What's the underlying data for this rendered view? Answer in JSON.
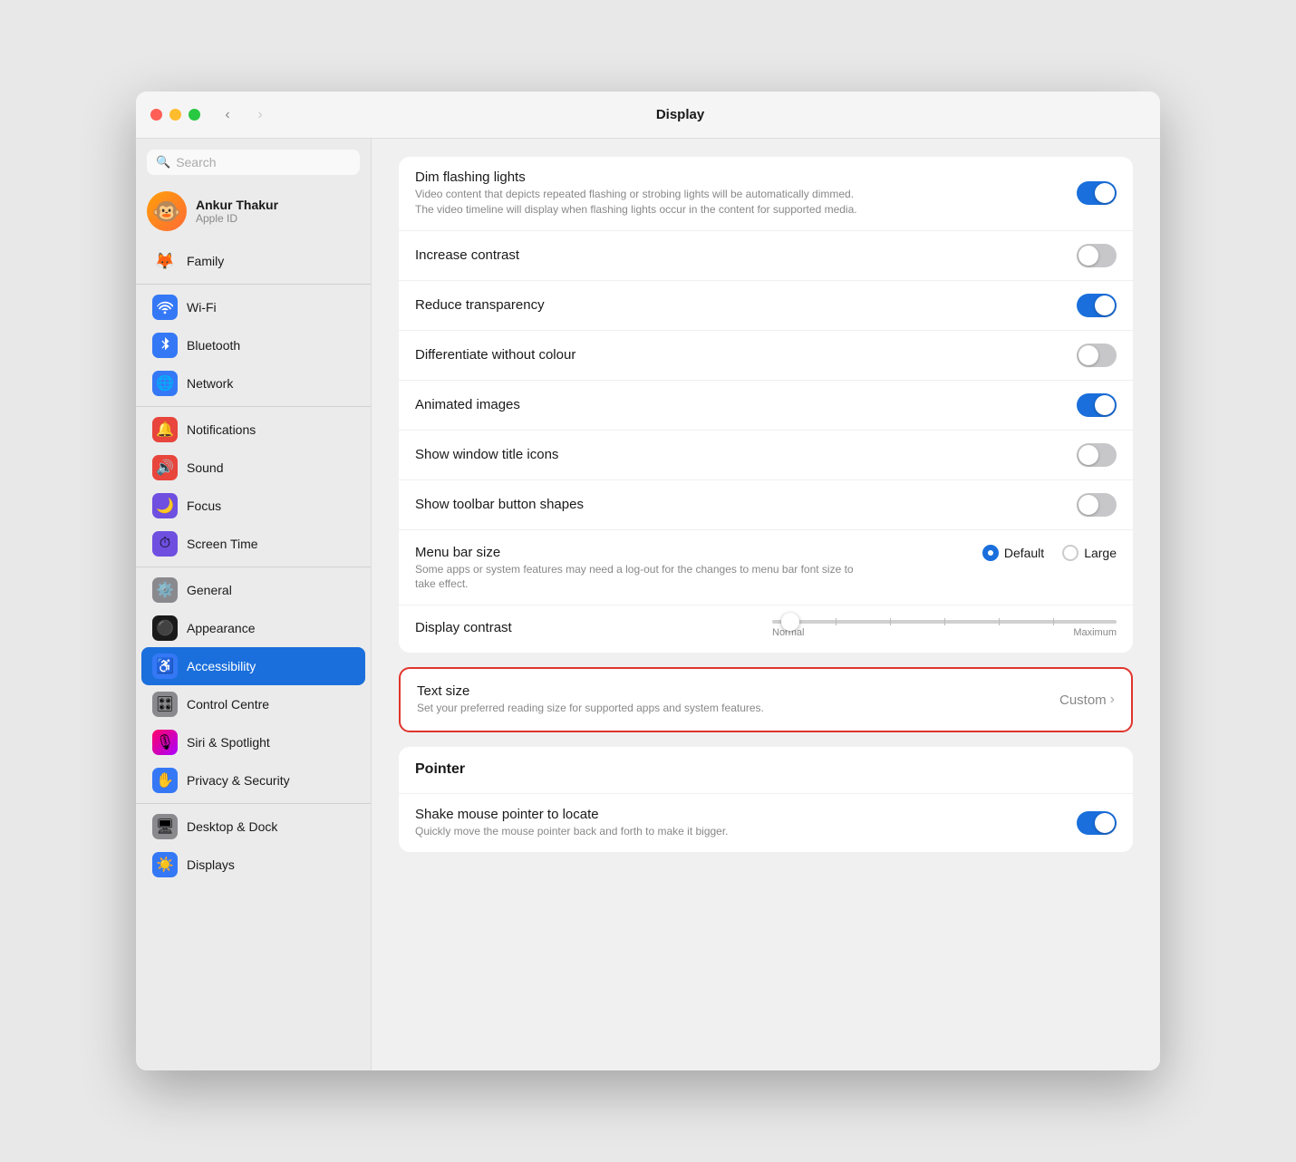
{
  "window": {
    "title": "Display"
  },
  "titlebar": {
    "back_label": "‹",
    "forward_label": "›"
  },
  "sidebar": {
    "search_placeholder": "Search",
    "user": {
      "name": "Ankur Thakur",
      "subtitle": "Apple ID",
      "avatar_emoji": "🐵"
    },
    "family": {
      "label": "Family",
      "emoji": "🦊"
    },
    "items": [
      {
        "id": "wifi",
        "label": "Wi-Fi",
        "bg": "#3478f6",
        "emoji": "📶"
      },
      {
        "id": "bluetooth",
        "label": "Bluetooth",
        "bg": "#3478f6",
        "emoji": "🔵"
      },
      {
        "id": "network",
        "label": "Network",
        "bg": "#3478f6",
        "emoji": "🌐"
      },
      {
        "id": "notifications",
        "label": "Notifications",
        "bg": "#e8453c",
        "emoji": "🔔"
      },
      {
        "id": "sound",
        "label": "Sound",
        "bg": "#e8453c",
        "emoji": "🔊"
      },
      {
        "id": "focus",
        "label": "Focus",
        "bg": "#6e4fe0",
        "emoji": "🌙"
      },
      {
        "id": "screen-time",
        "label": "Screen Time",
        "bg": "#6e4fe0",
        "emoji": "⏱"
      },
      {
        "id": "general",
        "label": "General",
        "bg": "#888",
        "emoji": "⚙️"
      },
      {
        "id": "appearance",
        "label": "Appearance",
        "bg": "#1a1a1a",
        "emoji": "⚫"
      },
      {
        "id": "accessibility",
        "label": "Accessibility",
        "bg": "#3478f6",
        "emoji": "♿"
      },
      {
        "id": "control-centre",
        "label": "Control Centre",
        "bg": "#888",
        "emoji": "🎛"
      },
      {
        "id": "siri-spotlight",
        "label": "Siri & Spotlight",
        "bg": "#e8453c",
        "emoji": "🎙"
      },
      {
        "id": "privacy-security",
        "label": "Privacy & Security",
        "bg": "#3478f6",
        "emoji": "✋"
      },
      {
        "id": "desktop-dock",
        "label": "Desktop & Dock",
        "bg": "#888",
        "emoji": "🖥"
      },
      {
        "id": "displays",
        "label": "Displays",
        "bg": "#3478f6",
        "emoji": "☀️"
      }
    ],
    "active_item": "accessibility"
  },
  "main": {
    "title": "Display",
    "dim_flashing_lights": {
      "label": "Dim flashing lights",
      "description": "Video content that depicts repeated flashing or strobing lights will be automatically dimmed. The video timeline will display when flashing lights occur in the content for supported media.",
      "value": true
    },
    "increase_contrast": {
      "label": "Increase contrast",
      "value": false
    },
    "reduce_transparency": {
      "label": "Reduce transparency",
      "value": true
    },
    "differentiate_without_colour": {
      "label": "Differentiate without colour",
      "value": false
    },
    "animated_images": {
      "label": "Animated images",
      "value": true
    },
    "show_window_title_icons": {
      "label": "Show window title icons",
      "value": false
    },
    "show_toolbar_button_shapes": {
      "label": "Show toolbar button shapes",
      "value": false
    },
    "menu_bar_size": {
      "label": "Menu bar size",
      "description": "Some apps or system features may need a log-out for the changes to menu bar font size to take effect.",
      "options": [
        "Default",
        "Large"
      ],
      "selected": "Default"
    },
    "display_contrast": {
      "label": "Display contrast",
      "min_label": "Normal",
      "max_label": "Maximum"
    },
    "text_size": {
      "label": "Text size",
      "description": "Set your preferred reading size for supported apps and system features.",
      "value": "Custom"
    },
    "pointer_section_label": "Pointer",
    "shake_mouse_pointer": {
      "label": "Shake mouse pointer to locate",
      "description": "Quickly move the mouse pointer back and forth to make it bigger.",
      "value": true
    }
  }
}
